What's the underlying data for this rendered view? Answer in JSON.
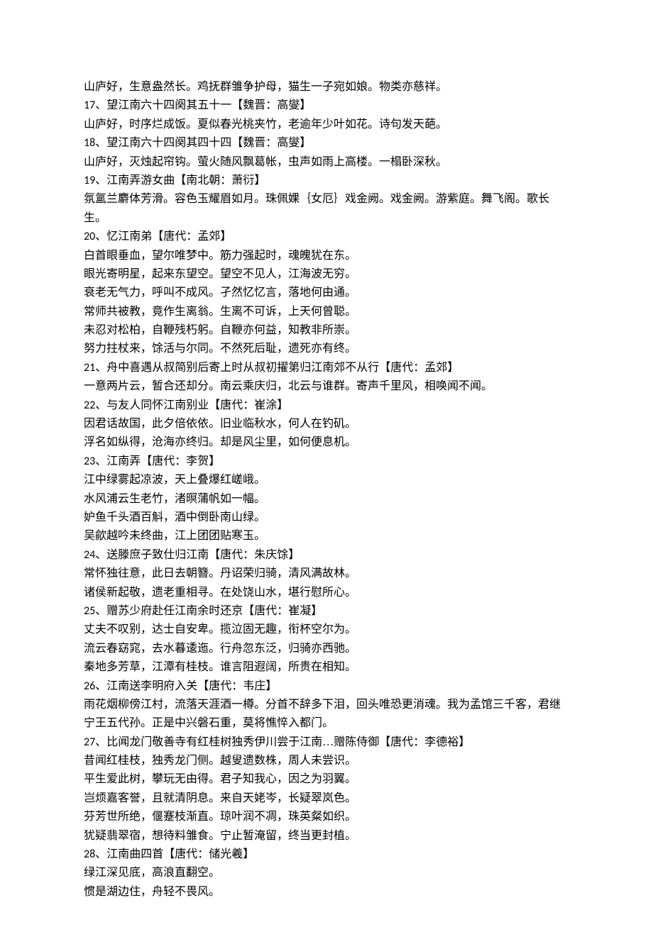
{
  "lines": [
    "山庐好，生意盎然长。鸡抚群雏争护母，猫生一子宛如娘。物类亦慈祥。",
    "17、望江南六十四阕其五十一【魏晋：高燮】",
    "山庐好，时序烂成饭。夏似春光桃夹竹，老逾年少叶如花。诗句发天葩。",
    "18、望江南六十四阕其四十四【魏晋：高燮】",
    "山庐好，灭烛起帘钩。萤火随风飘葛帐，虫声如雨上高楼。一榻卧深秋。",
    "19、江南弄游女曲【南北朝：萧衍】",
    "氛氲兰麝体芳滑。容色玉耀眉如月。珠佩婐｛女厄｝戏金阙。戏金阙。游紫庭。舞飞阁。歌长生。",
    "20、忆江南弟【唐代：孟郊】",
    "白首眼垂血，望尔唯梦中。筋力强起时，魂魄犹在东。",
    "眼光寄明星，起来东望空。望空不见人，江海波无穷。",
    "衰老无气力，呼叫不成风。孑然忆忆言，落地何由通。",
    "常师共被教，竟作生离翁。生离不可诉，上天何曾聪。",
    "未忍对松柏，自鞭残朽躬。自鞭亦何益，知教非所崇。",
    "努力拄杖来，馀活与尔同。不然死后耻，遗死亦有终。",
    "21、舟中喜遇从叔简别后寄上时从叔初擢第归江南郊不从行【唐代：孟郊】",
    "一意两片云，暂合还却分。南云乘庆归，北云与谁群。寄声千里风，相唤闻不闻。",
    "22、与友人同怀江南别业【唐代：崔涂】",
    "因君话故国，此夕倍依依。旧业临秋水，何人在钓矶。",
    "浮名如纵得，沧海亦终归。却是风尘里，如何便息机。",
    "23、江南弄【唐代：李贺】",
    "江中绿雾起凉波，天上叠爆红嵯峨。",
    "水风浦云生老竹，渚暝蒲帆如一幅。",
    "妒鱼千头酒百斛，酒中倒卧南山绿。",
    "吴歈越吟未终曲，江上团团贴寒玉。",
    "24、送滕庶子致仕归江南【唐代：朱庆馀】",
    "常怀独往意，此日去朝簪。丹诏荣归骑，清风满故林。",
    "诸侯新起敬，遗老重相寻。在处饶山水，堪行慰所心。",
    "25、赠苏少府赴任江南余时还京【唐代：崔凝】",
    "丈夫不叹别，达士自安卑。揽泣固无趣，衔杯空尔为。",
    "流云春窈窕，去水暮逶迤。行舟忽东泛，归骑亦西驰。",
    "秦地多芳草，江潭有桂枝。谁言阻遐阔，所贵在相知。",
    "26、江南送李明府入关【唐代：韦庄】",
    "雨花烟柳傍江村，流落天涯酒一樽。分首不辞多下泪，回头唯恐更消魂。我为孟馆三千客，君继宁王五代孙。正是中兴磐石重，莫将憔悴入都门。",
    "27、比闻龙门敬善寺有红桂树独秀伊川尝于江南…赠陈侍御【唐代：李德裕】",
    "昔闻红桂枝，独秀龙门侧。越叟遗数株，周人未尝识。",
    "平生爱此树，攀玩无由得。君子知我心，因之为羽翼。",
    "岂烦嘉客誉，且就清阴息。来自天姥岑，长疑翠岚色。",
    "芬芳世所绝，偃蹇枝渐直。琼叶润不凋，珠英粲如织。",
    "犹疑翡翠宿，想待料雏食。宁止暂淹留，终当更封植。",
    "28、江南曲四首【唐代：储光羲】",
    "绿江深见底，高浪直翻空。",
    "惯是湖边住，舟轻不畏风。"
  ]
}
